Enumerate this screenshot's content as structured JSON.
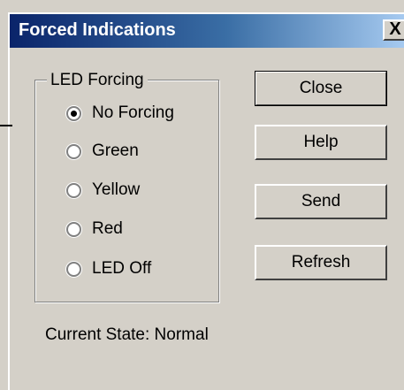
{
  "dialog": {
    "title": "Forced Indications",
    "close_glyph": "X"
  },
  "led_group": {
    "label": "LED Forcing",
    "options": [
      {
        "label": "No Forcing",
        "checked": true
      },
      {
        "label": "Green",
        "checked": false
      },
      {
        "label": "Yellow",
        "checked": false
      },
      {
        "label": "Red",
        "checked": false
      },
      {
        "label": "LED Off",
        "checked": false
      }
    ]
  },
  "buttons": {
    "close": "Close",
    "help": "Help",
    "send": "Send",
    "refresh": "Refresh"
  },
  "status": {
    "text": "Current State: Normal"
  },
  "colors": {
    "face": "#d4d0c8",
    "title_start": "#0a246a",
    "title_end": "#a6caf0"
  }
}
